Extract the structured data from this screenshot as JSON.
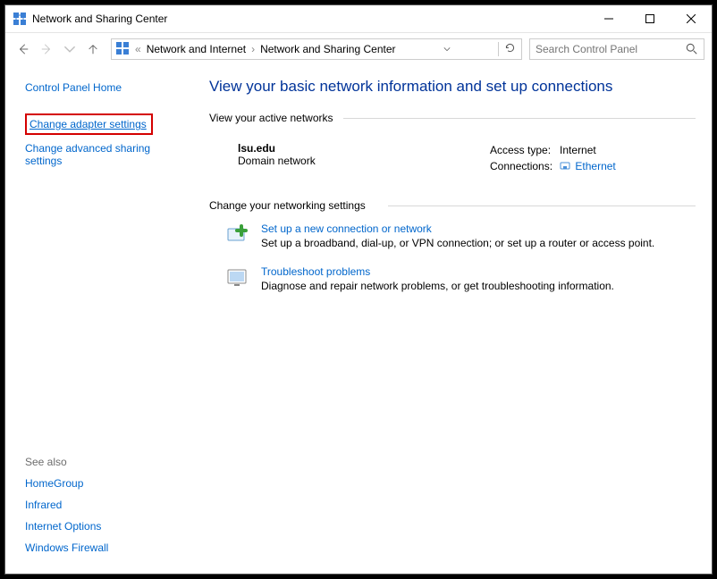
{
  "window": {
    "title": "Network and Sharing Center"
  },
  "breadcrumb": {
    "prefix": "«",
    "parent": "Network and Internet",
    "current": "Network and Sharing Center"
  },
  "search": {
    "placeholder": "Search Control Panel"
  },
  "sidebar": {
    "home": "Control Panel Home",
    "change_adapter": "Change adapter settings",
    "change_advanced": "Change advanced sharing settings",
    "see_also_label": "See also",
    "see_also": {
      "homegroup": "HomeGroup",
      "infrared": "Infrared",
      "internet_options": "Internet Options",
      "windows_firewall": "Windows Firewall"
    }
  },
  "main": {
    "title": "View your basic network information and set up connections",
    "active_label": "View your active networks",
    "network": {
      "name": "lsu.edu",
      "type": "Domain network",
      "access_label": "Access type:",
      "access_value": "Internet",
      "conn_label": "Connections:",
      "conn_value": "Ethernet"
    },
    "change_label": "Change your networking settings",
    "actions": {
      "new_conn": {
        "title": "Set up a new connection or network",
        "desc": "Set up a broadband, dial-up, or VPN connection; or set up a router or access point."
      },
      "troubleshoot": {
        "title": "Troubleshoot problems",
        "desc": "Diagnose and repair network problems, or get troubleshooting information."
      }
    }
  }
}
